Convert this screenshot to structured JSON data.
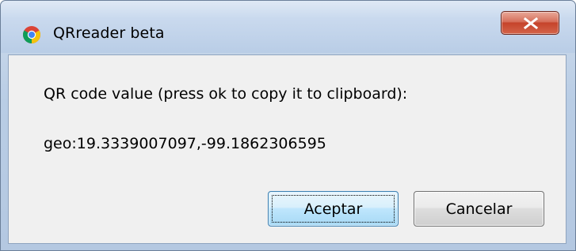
{
  "window": {
    "title": "QRreader beta",
    "app_icon": "chrome-icon",
    "close_icon": "close-icon"
  },
  "dialog": {
    "message": "QR code value (press ok to copy it to clipboard):",
    "value": "geo:19.3339007097,-99.1862306595"
  },
  "buttons": {
    "ok_label": "Aceptar",
    "cancel_label": "Cancelar"
  },
  "colors": {
    "titlebar": "#c9d9ee",
    "close_button": "#c5432b",
    "client_background": "#f0f0f0",
    "default_button_border": "#3c7fb1"
  }
}
